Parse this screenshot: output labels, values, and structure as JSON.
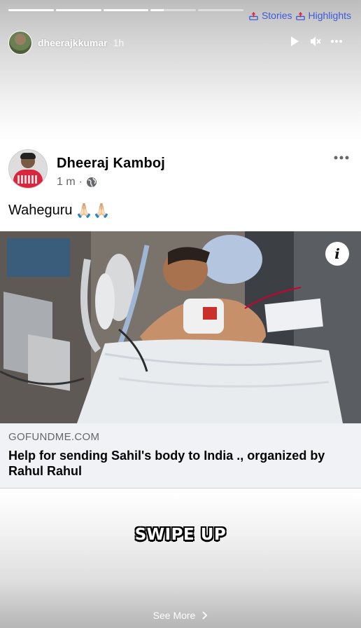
{
  "story": {
    "username": "dheerajkkumar",
    "time": "1h",
    "progress": [
      1,
      1,
      1,
      0.28,
      0
    ],
    "links": {
      "stories_label": "Stories",
      "highlights_label": "Highlights"
    }
  },
  "post": {
    "author": "Dheeraj Kamboj",
    "time": "1 m",
    "separator": "·",
    "text": "Waheguru",
    "emoji": "🙏🏻🙏🏻",
    "link": {
      "domain": "GOFUNDME.COM",
      "title": "Help for sending Sahil's body to India ., organized by Rahul Rahul"
    }
  },
  "sticker": {
    "text": "SWIPE UP"
  },
  "footer": {
    "see_more_label": "See More"
  },
  "colors": {
    "link_blue": "#3b5bdb",
    "fb_text": "#050505",
    "fb_meta": "#65676b",
    "preview_bg": "#f0f2f5"
  }
}
